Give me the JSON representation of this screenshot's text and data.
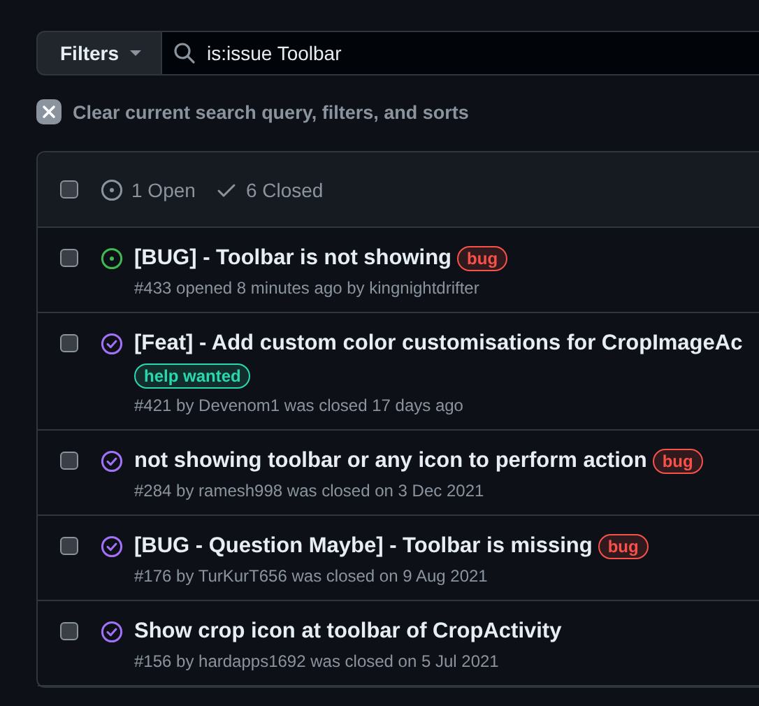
{
  "filters_button": {
    "label": "Filters"
  },
  "search": {
    "value": "is:issue Toolbar"
  },
  "clear_filters": {
    "label": "Clear current search query, filters, and sorts"
  },
  "header": {
    "checked": false,
    "open_count": "1 Open",
    "closed_count": "6 Closed"
  },
  "issues": [
    {
      "kind": "open",
      "checked": false,
      "title": "[BUG] - Toolbar is not showing",
      "labels": [
        {
          "name": "bug",
          "color": "#f85149"
        }
      ],
      "meta": "#433 opened 8 minutes ago by kingnightdrifter"
    },
    {
      "kind": "closed",
      "checked": false,
      "title": "[Feat] - Add custom color customisations for CropImageAc",
      "labels": [
        {
          "name": "help wanted",
          "color": "#2ad8b0"
        }
      ],
      "meta": "#421 by Devenom1 was closed 17 days ago",
      "labels_below": true
    },
    {
      "kind": "closed",
      "checked": false,
      "title": "not showing toolbar or any icon to perform action",
      "labels": [
        {
          "name": "bug",
          "color": "#f85149"
        }
      ],
      "meta": "#284 by ramesh998 was closed on 3 Dec 2021"
    },
    {
      "kind": "closed",
      "checked": false,
      "title": "[BUG - Question Maybe] - Toolbar is missing",
      "labels": [
        {
          "name": "bug",
          "color": "#f85149"
        }
      ],
      "meta": "#176 by TurKurT656 was closed on 9 Aug 2021"
    },
    {
      "kind": "closed",
      "checked": false,
      "title": "Show crop icon at toolbar of CropActivity",
      "meta": "#156 by hardapps1692 was closed on 5 Jul 2021"
    }
  ]
}
